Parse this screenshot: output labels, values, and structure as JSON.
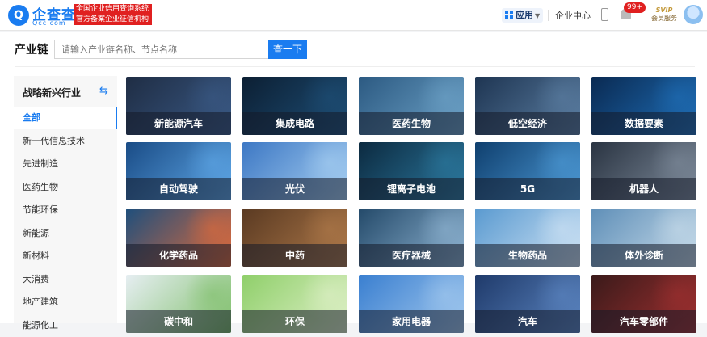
{
  "header": {
    "logo_mark": "Q",
    "logo_name": "企查查",
    "logo_domain": "Qcc.com",
    "slogan_line1": "全国企业信用查询系统",
    "slogan_line2": "官方备案企业征信机构",
    "apps_label": "应用",
    "enterprise_center": "企业中心",
    "notification_count": "99+",
    "svip_label": "SVIP",
    "member_service": "会员服务"
  },
  "page": {
    "title": "产业链",
    "search_placeholder": "请输入产业链名称、节点名称",
    "search_button": "查一下"
  },
  "sidebar": {
    "heading": "战略新兴行业",
    "swap_icon": "⇆",
    "items": [
      "全部",
      "新一代信息技术",
      "先进制造",
      "医药生物",
      "节能环保",
      "新能源",
      "新材料",
      "大消费",
      "地产建筑",
      "能源化工"
    ],
    "active_index": 0
  },
  "cards": [
    {
      "label": "新能源汽车",
      "icon": "ev-car-image",
      "colors": [
        "#1f2d44",
        "#3a5a86"
      ]
    },
    {
      "label": "集成电路",
      "icon": "chip-image",
      "colors": [
        "#0c1f33",
        "#1e4f77"
      ]
    },
    {
      "label": "医药生物",
      "icon": "lab-image",
      "colors": [
        "#2c5a82",
        "#6ea3c8"
      ]
    },
    {
      "label": "低空经济",
      "icon": "drone-image",
      "colors": [
        "#1e3552",
        "#5c7fa3"
      ]
    },
    {
      "label": "数据要素",
      "icon": "data-city-image",
      "colors": [
        "#0a2a52",
        "#1f6fb8"
      ]
    },
    {
      "label": "自动驾驶",
      "icon": "autonomous-car-image",
      "colors": [
        "#1a4c86",
        "#5fa8e8"
      ]
    },
    {
      "label": "光伏",
      "icon": "solar-panel-image",
      "colors": [
        "#3d78c4",
        "#a8d0f2"
      ]
    },
    {
      "label": "锂离子电池",
      "icon": "battery-image",
      "colors": [
        "#0c2a40",
        "#2c7aa0"
      ]
    },
    {
      "label": "5G",
      "icon": "5g-network-image",
      "colors": [
        "#0f3f6e",
        "#4d9ad6"
      ]
    },
    {
      "label": "机器人",
      "icon": "robot-image",
      "colors": [
        "#2a3442",
        "#7f8c9c"
      ]
    },
    {
      "label": "化学药品",
      "icon": "chemistry-image",
      "colors": [
        "#1f4f7c",
        "#e06a3a"
      ]
    },
    {
      "label": "中药",
      "icon": "herbal-medicine-image",
      "colors": [
        "#5a3a22",
        "#b07a4a"
      ]
    },
    {
      "label": "医疗器械",
      "icon": "microscope-image",
      "colors": [
        "#244a6a",
        "#8fb4d2"
      ]
    },
    {
      "label": "生物药品",
      "icon": "molecule-image",
      "colors": [
        "#5a9ad0",
        "#cfe3f4"
      ]
    },
    {
      "label": "体外诊断",
      "icon": "test-tube-image",
      "colors": [
        "#5f8fb8",
        "#c8dcea"
      ]
    },
    {
      "label": "碳中和",
      "icon": "green-earth-image",
      "colors": [
        "#e6eef2",
        "#7fbf6a"
      ]
    },
    {
      "label": "环保",
      "icon": "sapling-image",
      "colors": [
        "#8fcf6a",
        "#dff0c8"
      ]
    },
    {
      "label": "家用电器",
      "icon": "appliances-image",
      "colors": [
        "#3a7fd0",
        "#a3c9ee"
      ]
    },
    {
      "label": "汽车",
      "icon": "sports-car-image",
      "colors": [
        "#1f3a6a",
        "#5c86c2"
      ]
    },
    {
      "label": "汽车零部件",
      "icon": "gears-image",
      "colors": [
        "#3a1a1a",
        "#a03030"
      ]
    }
  ]
}
